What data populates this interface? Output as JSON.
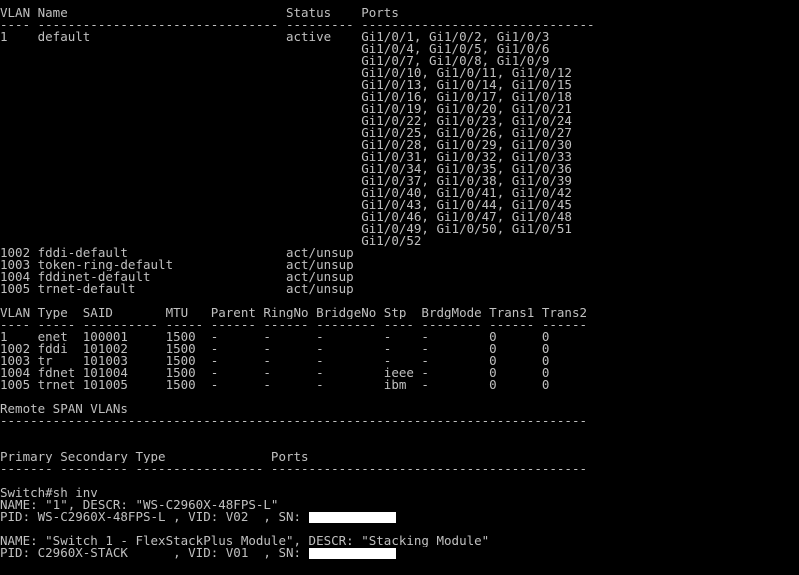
{
  "colors": {
    "background": "#000000",
    "foreground": "#c0c0c0",
    "redaction": "#ffffff"
  },
  "terminal": {
    "lines": [
      {
        "text": "VLAN Name                             Status    Ports"
      },
      {
        "text": "---- -------------------------------- --------- -------------------------------"
      },
      {
        "text": "1    default                          active    Gi1/0/1, Gi1/0/2, Gi1/0/3"
      },
      {
        "text": "                                                Gi1/0/4, Gi1/0/5, Gi1/0/6"
      },
      {
        "text": "                                                Gi1/0/7, Gi1/0/8, Gi1/0/9"
      },
      {
        "text": "                                                Gi1/0/10, Gi1/0/11, Gi1/0/12"
      },
      {
        "text": "                                                Gi1/0/13, Gi1/0/14, Gi1/0/15"
      },
      {
        "text": "                                                Gi1/0/16, Gi1/0/17, Gi1/0/18"
      },
      {
        "text": "                                                Gi1/0/19, Gi1/0/20, Gi1/0/21"
      },
      {
        "text": "                                                Gi1/0/22, Gi1/0/23, Gi1/0/24"
      },
      {
        "text": "                                                Gi1/0/25, Gi1/0/26, Gi1/0/27"
      },
      {
        "text": "                                                Gi1/0/28, Gi1/0/29, Gi1/0/30"
      },
      {
        "text": "                                                Gi1/0/31, Gi1/0/32, Gi1/0/33"
      },
      {
        "text": "                                                Gi1/0/34, Gi1/0/35, Gi1/0/36"
      },
      {
        "text": "                                                Gi1/0/37, Gi1/0/38, Gi1/0/39"
      },
      {
        "text": "                                                Gi1/0/40, Gi1/0/41, Gi1/0/42"
      },
      {
        "text": "                                                Gi1/0/43, Gi1/0/44, Gi1/0/45"
      },
      {
        "text": "                                                Gi1/0/46, Gi1/0/47, Gi1/0/48"
      },
      {
        "text": "                                                Gi1/0/49, Gi1/0/50, Gi1/0/51"
      },
      {
        "text": "                                                Gi1/0/52"
      },
      {
        "text": "1002 fddi-default                     act/unsup"
      },
      {
        "text": "1003 token-ring-default               act/unsup"
      },
      {
        "text": "1004 fddinet-default                  act/unsup"
      },
      {
        "text": "1005 trnet-default                    act/unsup"
      },
      {
        "text": ""
      },
      {
        "text": "VLAN Type  SAID       MTU   Parent RingNo BridgeNo Stp  BrdgMode Trans1 Trans2"
      },
      {
        "text": "---- ----- ---------- ----- ------ ------ -------- ---- -------- ------ ------"
      },
      {
        "text": "1    enet  100001     1500  -      -      -        -    -        0      0"
      },
      {
        "text": "1002 fddi  101002     1500  -      -      -        -    -        0      0"
      },
      {
        "text": "1003 tr    101003     1500  -      -      -        -    -        0      0"
      },
      {
        "text": "1004 fdnet 101004     1500  -      -      -        ieee -        0      0"
      },
      {
        "text": "1005 trnet 101005     1500  -      -      -        ibm  -        0      0"
      },
      {
        "text": ""
      },
      {
        "text": "Remote SPAN VLANs"
      },
      {
        "text": "------------------------------------------------------------------------------"
      },
      {
        "text": ""
      },
      {
        "text": ""
      },
      {
        "text": "Primary Secondary Type              Ports"
      },
      {
        "text": "------- --------- ----------------- ------------------------------------------"
      },
      {
        "text": ""
      },
      {
        "text": "Switch#sh inv"
      },
      {
        "text": "NAME: \"1\", DESCR: \"WS-C2960X-48FPS-L\""
      },
      {
        "text": "PID: WS-C2960X-48FPS-L , VID: V02  , SN: ",
        "redacted": true
      },
      {
        "text": ""
      },
      {
        "text": "NAME: \"Switch 1 - FlexStackPlus Module\", DESCR: \"Stacking Module\""
      },
      {
        "text": "PID: C2960X-STACK      , VID: V01  , SN: ",
        "redacted": true
      }
    ]
  }
}
